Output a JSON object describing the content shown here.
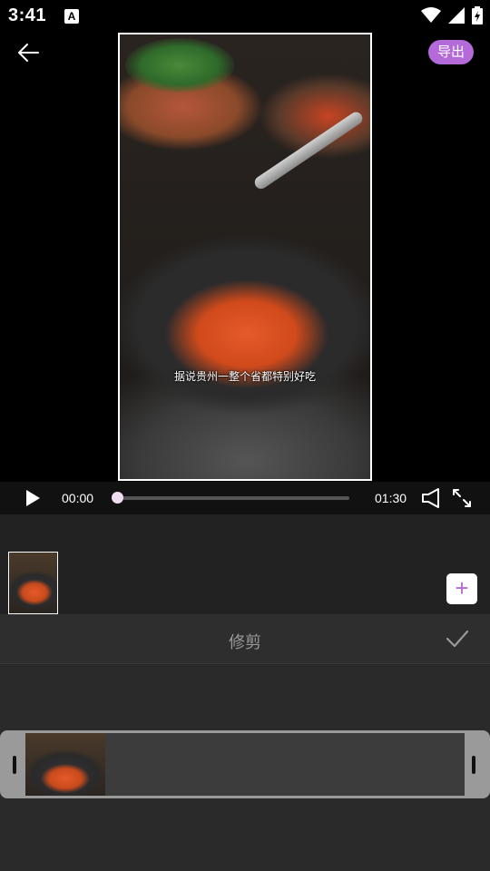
{
  "status_bar": {
    "time": "3:41",
    "notification_icon": "A",
    "icons": [
      "wifi-icon",
      "signal-icon",
      "battery-icon"
    ]
  },
  "toolbar": {
    "back_icon": "arrow-left-icon",
    "export_label": "导出"
  },
  "video": {
    "subtitle": "据说贵州一整个省都特别好吃"
  },
  "player": {
    "current_time": "00:00",
    "total_time": "01:30",
    "progress": 0,
    "play_icon": "play-icon",
    "volume_icon": "volume-icon",
    "fullscreen_icon": "fullscreen-icon"
  },
  "timeline": {
    "add_label": "+"
  },
  "trim_panel": {
    "title": "修剪",
    "confirm_icon": "check-icon"
  },
  "colors": {
    "accent": "#b56ad9",
    "background": "#000000",
    "panel": "#2a2a2a"
  }
}
